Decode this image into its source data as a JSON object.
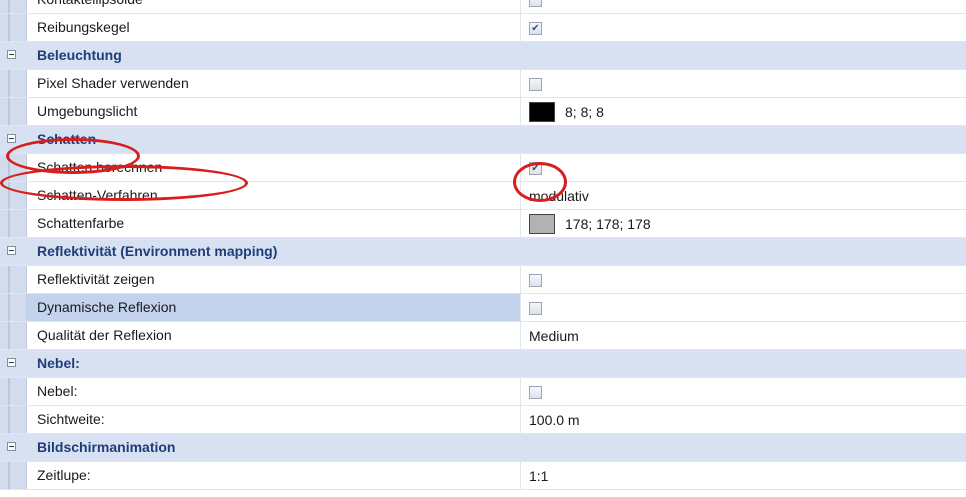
{
  "rows": [
    {
      "kind": "prop",
      "name": "Kontaktellipsoide",
      "type": "checkbox",
      "checked": false
    },
    {
      "kind": "prop",
      "name": "Reibungskegel",
      "type": "checkbox",
      "checked": true
    },
    {
      "kind": "cat",
      "title": "Beleuchtung"
    },
    {
      "kind": "prop",
      "name": "Pixel Shader verwenden",
      "type": "checkbox",
      "checked": false
    },
    {
      "kind": "prop",
      "name": "Umgebungslicht",
      "type": "color",
      "color": "#000000",
      "value": "8; 8; 8"
    },
    {
      "kind": "cat",
      "title": "Schatten"
    },
    {
      "kind": "prop",
      "name": "Schatten berechnen",
      "type": "checkbox",
      "checked": true
    },
    {
      "kind": "prop",
      "name": "Schatten-Verfahren",
      "type": "text",
      "value": "modulativ"
    },
    {
      "kind": "prop",
      "name": "Schattenfarbe",
      "type": "color",
      "color": "#b2b2b2",
      "value": "178; 178; 178"
    },
    {
      "kind": "cat",
      "title": "Reflektivität (Environment mapping)"
    },
    {
      "kind": "prop",
      "name": "Reflektivität zeigen",
      "type": "checkbox",
      "checked": false
    },
    {
      "kind": "prop",
      "name": "Dynamische Reflexion",
      "type": "checkbox",
      "checked": false,
      "selected": true
    },
    {
      "kind": "prop",
      "name": "Qualität der Reflexion",
      "type": "text",
      "value": "Medium"
    },
    {
      "kind": "cat",
      "title": "Nebel:"
    },
    {
      "kind": "prop",
      "name": "Nebel:",
      "type": "checkbox",
      "checked": false
    },
    {
      "kind": "prop",
      "name": "Sichtweite:",
      "type": "text",
      "value": "100.0 m"
    },
    {
      "kind": "cat",
      "title": "Bildschirmanimation"
    },
    {
      "kind": "prop",
      "name": "Zeitlupe:",
      "type": "text",
      "value": "1:1"
    }
  ],
  "colors": {
    "annotation": "#d91d1d",
    "category_bg": "#d7e1f1",
    "selection_bg": "#c3d3ee"
  }
}
